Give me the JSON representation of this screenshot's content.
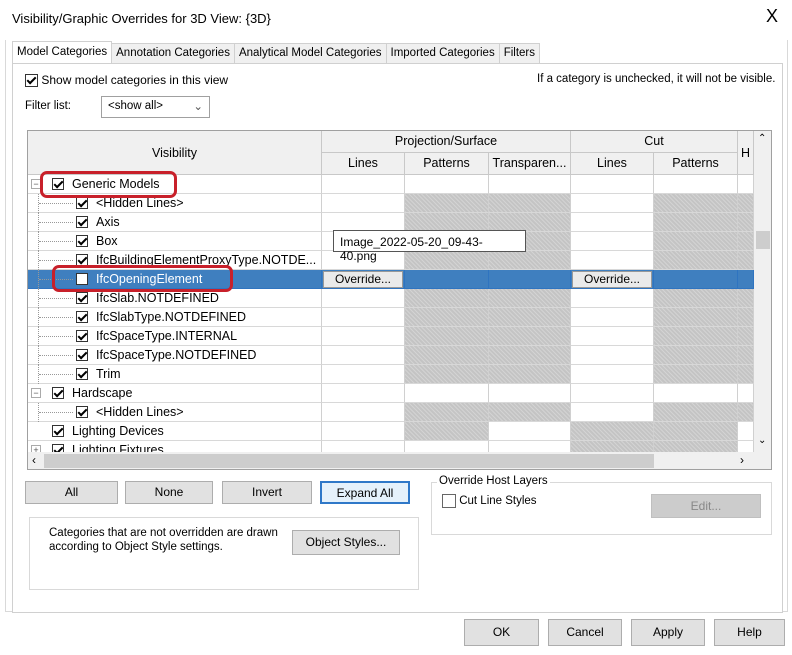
{
  "window": {
    "title": "Visibility/Graphic Overrides for 3D View: {3D}",
    "close_label": "X"
  },
  "tabs": [
    {
      "label": "Model Categories",
      "active": true
    },
    {
      "label": "Annotation Categories"
    },
    {
      "label": "Analytical Model Categories"
    },
    {
      "label": "Imported Categories"
    },
    {
      "label": "Filters"
    }
  ],
  "show_categories": {
    "label": "Show model categories in this view",
    "checked": true
  },
  "hint": "If a category is unchecked, it will not be visible.",
  "filter": {
    "label": "Filter list:",
    "value": "<show all>"
  },
  "table": {
    "headers": {
      "visibility": "Visibility",
      "projection": "Projection/Surface",
      "cut": "Cut",
      "proj_lines": "Lines",
      "proj_patterns": "Patterns",
      "proj_transparency": "Transparen...",
      "cut_lines": "Lines",
      "cut_patterns": "Patterns",
      "halftone": "H"
    },
    "rows": [
      {
        "label": "Generic Models",
        "level": 0,
        "checked": true,
        "expand": "minus",
        "gray": [
          0,
          0,
          0,
          0,
          0,
          0
        ]
      },
      {
        "label": "<Hidden Lines>",
        "level": 1,
        "checked": true,
        "gray": [
          0,
          1,
          1,
          0,
          1,
          1
        ]
      },
      {
        "label": "Axis",
        "level": 1,
        "checked": true,
        "gray": [
          0,
          1,
          1,
          0,
          1,
          1
        ]
      },
      {
        "label": "Box",
        "level": 1,
        "checked": true,
        "gray": [
          0,
          1,
          1,
          0,
          1,
          1
        ]
      },
      {
        "label": "IfcBuildingElementProxyType.NOTDE...",
        "level": 1,
        "checked": true,
        "gray": [
          0,
          1,
          1,
          0,
          1,
          1
        ]
      },
      {
        "label": "IfcOpeningElement",
        "level": 1,
        "checked": false,
        "selected": true,
        "override_label": "Override...",
        "gray": [
          0,
          1,
          1,
          0,
          1,
          1
        ]
      },
      {
        "label": "IfcSlab.NOTDEFINED",
        "level": 1,
        "checked": true,
        "gray": [
          0,
          1,
          1,
          0,
          1,
          1
        ]
      },
      {
        "label": "IfcSlabType.NOTDEFINED",
        "level": 1,
        "checked": true,
        "gray": [
          0,
          1,
          1,
          0,
          1,
          1
        ]
      },
      {
        "label": "IfcSpaceType.INTERNAL",
        "level": 1,
        "checked": true,
        "gray": [
          0,
          1,
          1,
          0,
          1,
          1
        ]
      },
      {
        "label": "IfcSpaceType.NOTDEFINED",
        "level": 1,
        "checked": true,
        "gray": [
          0,
          1,
          1,
          0,
          1,
          1
        ]
      },
      {
        "label": "Trim",
        "level": 1,
        "checked": true,
        "gray": [
          0,
          1,
          1,
          0,
          1,
          1
        ]
      },
      {
        "label": "Hardscape",
        "level": 0,
        "checked": true,
        "expand": "minus",
        "gray": [
          0,
          0,
          0,
          0,
          0,
          0
        ]
      },
      {
        "label": "<Hidden Lines>",
        "level": 1,
        "checked": true,
        "gray": [
          0,
          1,
          1,
          0,
          1,
          1
        ]
      },
      {
        "label": "Lighting Devices",
        "level": 0,
        "checked": true,
        "gray": [
          0,
          1,
          0,
          1,
          1,
          0
        ]
      },
      {
        "label": "Lighting Fixtures",
        "level": 0,
        "checked": true,
        "expand": "plus",
        "gray": [
          0,
          0,
          0,
          1,
          1,
          0
        ]
      }
    ]
  },
  "tooltip": "Image_2022-05-20_09-43-40.png",
  "buttons": {
    "all": "All",
    "none": "None",
    "invert": "Invert",
    "expand_all": "Expand All",
    "object_styles": "Object Styles...",
    "edit": "Edit...",
    "ok": "OK",
    "cancel": "Cancel",
    "apply": "Apply",
    "help": "Help"
  },
  "note": "Categories that are not overridden are drawn according to Object Style settings.",
  "host_layers": {
    "legend": "Override Host Layers",
    "cut_line_styles": "Cut Line Styles",
    "checked": false
  },
  "colors": {
    "selection": "#3f7fbf",
    "annotation": "#c8202a"
  }
}
